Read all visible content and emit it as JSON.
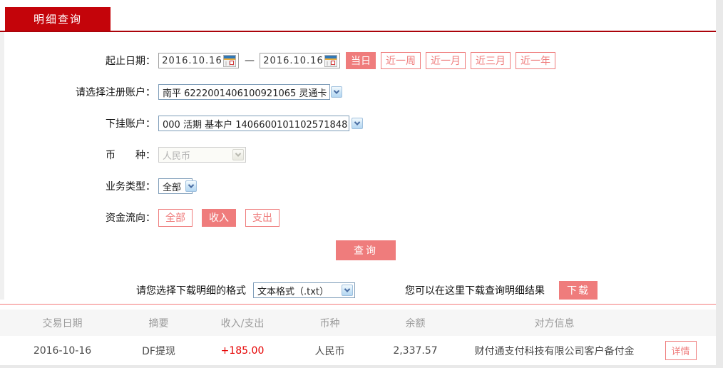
{
  "colors": {
    "brand-red": "#c4040a",
    "line-red": "#ab030a",
    "salmon": "#ef7c7c",
    "income-red": "#e60000"
  },
  "tab": {
    "label": "明细查询"
  },
  "form": {
    "date_range": {
      "label": "起止日期：",
      "start": "2016.10.16",
      "end": "2016.10.16",
      "separator": "—",
      "quick_buttons": [
        {
          "label": "当日",
          "active": true
        },
        {
          "label": "近一周",
          "active": false
        },
        {
          "label": "近一月",
          "active": false
        },
        {
          "label": "近三月",
          "active": false
        },
        {
          "label": "近一年",
          "active": false
        }
      ]
    },
    "register_account": {
      "label": "请选择注册账户：",
      "value": "南平 6222001406100921065 灵通卡"
    },
    "sub_account": {
      "label": "下挂账户：",
      "value": "000 活期 基本户 1406600101102571848"
    },
    "currency": {
      "label": "币　　种：",
      "value": "人民币",
      "disabled": true
    },
    "business_type": {
      "label": "业务类型：",
      "value": "全部"
    },
    "fund_flow": {
      "label": "资金流向：",
      "options": [
        {
          "label": "全部",
          "active": false
        },
        {
          "label": "收入",
          "active": true
        },
        {
          "label": "支出",
          "active": false
        }
      ]
    },
    "query_button": "查询"
  },
  "download": {
    "format_label": "请您选择下载明细的格式",
    "format_value": "文本格式（.txt）",
    "hint": "您可以在这里下载查询明细结果",
    "button": "下载"
  },
  "table": {
    "headers": [
      "交易日期",
      "摘要",
      "收入/支出",
      "币种",
      "余额",
      "对方信息"
    ],
    "rows": [
      {
        "date": "2016-10-16",
        "summary": "DF提现",
        "amount": "+185.00",
        "currency": "人民币",
        "balance": "2,337.57",
        "counterparty": "财付通支付科技有限公司客户备付金",
        "action": "详情"
      }
    ]
  }
}
